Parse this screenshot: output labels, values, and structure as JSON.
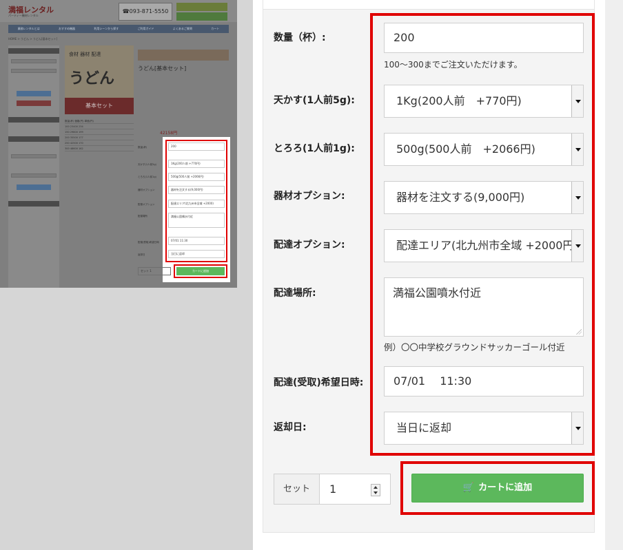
{
  "thumbnail": {
    "logo": "満福レンタル",
    "logo_sub": "パーティー機材レンタル",
    "phone": "☎093-871-5550",
    "nav": [
      "業務レンタルとは",
      "おすすめ機器",
      "利用シーンから探す",
      "ご利用ガイド",
      "よくあるご質問",
      "カート"
    ],
    "breadcrumb": "HOME > うどん > うどん[基本セット]",
    "image_title": "うどん",
    "image_tags": "食材 器材 配達",
    "image_caption": "基本セット",
    "product_title": "うどん[基本セット]",
    "price": "42158円",
    "table_rows": [
      "数量(杯)  価格(円)  単価(円)",
      "100  23400  234",
      "150  29800  199",
      "200  35500  177",
      "250  42500  170",
      "300  48600  162"
    ],
    "form_labels": [
      "数量(杯)",
      "天かす(1人前5g)",
      "とろろ(1人前1g)",
      "器材オプション",
      "配達オプション",
      "配達場所",
      "配達(受取)希望日時",
      "返却日"
    ],
    "mini_fields": [
      "200",
      "1Kg(200人前 +770円)",
      "500g(500人前 +2066円)",
      "器材を注文する(9,000円)",
      "配達エリア(北九州市全域 +2000)",
      "満福公園噴水付近",
      "07/01 11:30",
      "当日に返却"
    ],
    "mini_cart": "カートに追加",
    "mini_set": "セット 1"
  },
  "form": {
    "quantity": {
      "label": "数量（杯）:",
      "value": "200",
      "hint": "100〜300までご注文いただけます。"
    },
    "tenkasu": {
      "label": "天かす(1人前5g):",
      "value": "1Kg(200人前　+770円)"
    },
    "tororo": {
      "label": "とろろ(1人前1g):",
      "value": "500g(500人前　+2066円)"
    },
    "equipment": {
      "label": "器材オプション:",
      "value": "器材を注文する(9,000円)"
    },
    "delivery": {
      "label": "配達オプション:",
      "value": "配達エリア(北九州市全域 +2000円"
    },
    "location": {
      "label": "配達場所:",
      "value": "満福公園噴水付近",
      "hint": "例）〇〇中学校グラウンドサッカーゴール付近"
    },
    "datetime": {
      "label": "配達(受取)希望日時:",
      "value": "07/01　 11:30"
    },
    "return_day": {
      "label": "返却日:",
      "value": "当日に返却"
    }
  },
  "set": {
    "label": "セット",
    "value": "1"
  },
  "cart": {
    "label": "カートに追加",
    "icon": "cart-icon"
  },
  "colors": {
    "highlight": "#e00000",
    "cart_button": "#5cb85c"
  }
}
